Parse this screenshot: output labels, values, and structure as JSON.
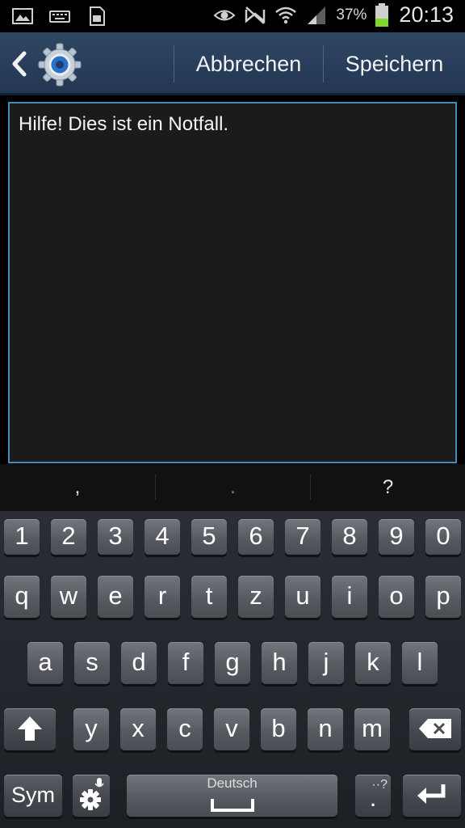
{
  "status_bar": {
    "left_icons": [
      "image-icon",
      "keyboard-icon",
      "sim-card-icon"
    ],
    "right_icons": [
      "eye-icon",
      "no-signal-icon",
      "wifi-icon",
      "cellular-signal-icon",
      "battery-icon"
    ],
    "battery_percent": "37%",
    "battery_level": 0.37,
    "time": "20:13"
  },
  "action_bar": {
    "cancel_label": "Abbrechen",
    "save_label": "Speichern"
  },
  "editor": {
    "text": "Hilfe! Dies ist ein Notfall."
  },
  "suggestions": [
    ",",
    ".",
    "?"
  ],
  "keyboard": {
    "row_numbers": [
      "1",
      "2",
      "3",
      "4",
      "5",
      "6",
      "7",
      "8",
      "9",
      "0"
    ],
    "row_1": [
      "q",
      "w",
      "e",
      "r",
      "t",
      "z",
      "u",
      "i",
      "o",
      "p"
    ],
    "row_2": [
      "a",
      "s",
      "d",
      "f",
      "g",
      "h",
      "j",
      "k",
      "l"
    ],
    "row_3": [
      "y",
      "x",
      "c",
      "v",
      "b",
      "n",
      "m"
    ],
    "sym_label": "Sym",
    "space_label": "Deutsch",
    "period_label": ".",
    "colors": {
      "accent": "#3d8db5"
    }
  }
}
